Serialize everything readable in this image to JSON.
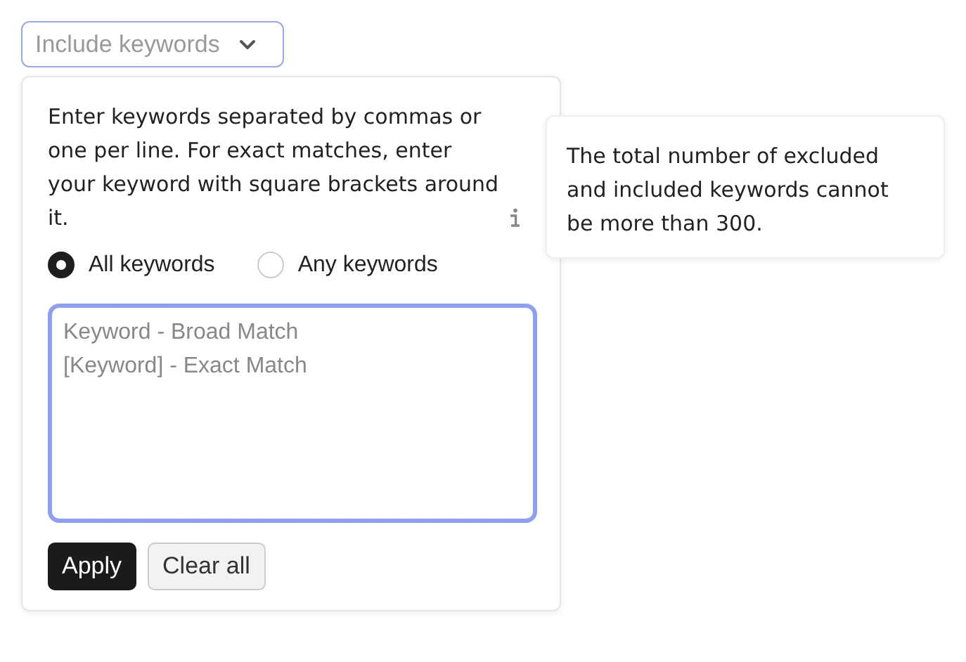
{
  "dropdown": {
    "label": "Include keywords",
    "expanded": true
  },
  "panel": {
    "instructions": "Enter keywords separated by commas or one per line. For exact matches, enter your keyword with square brackets around it.",
    "tooltip": "The total number of excluded and included keywords cannot be more than 300.",
    "match_options": [
      {
        "label": "All keywords",
        "selected": true
      },
      {
        "label": "Any keywords",
        "selected": false
      }
    ],
    "keywords_field": {
      "placeholder": "Keyword - Broad Match\n[Keyword] - Exact Match"
    },
    "buttons": [
      {
        "label": "Apply",
        "kind": "primary"
      },
      {
        "label": "Clear all",
        "kind": "secondary"
      }
    ]
  }
}
